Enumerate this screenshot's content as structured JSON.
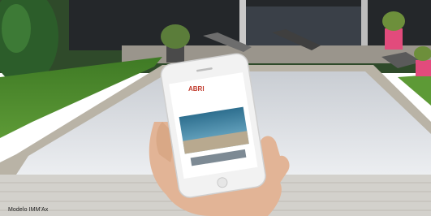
{
  "caption": "Modelo IMM'Ax",
  "phone_app": {
    "logo_text": "ABRI",
    "tagline": "",
    "button_label": ""
  },
  "colors": {
    "lawn": "#4b8a2f",
    "pool_cover": "#dcdfe4",
    "house_dark": "#24272a",
    "planter_pink": "#e24b7c",
    "phone_body": "#f2f2f2",
    "brand_red": "#c0392b"
  }
}
